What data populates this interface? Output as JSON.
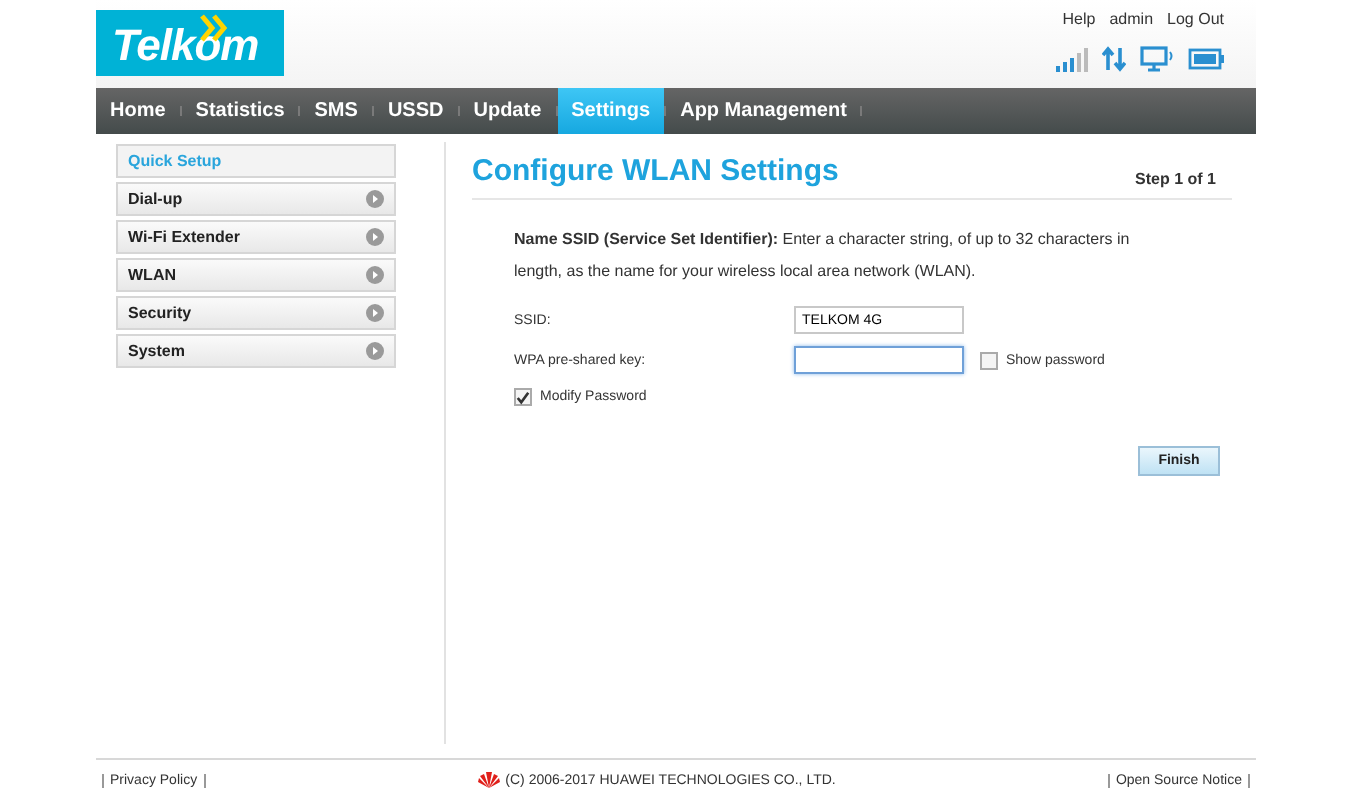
{
  "logo": {
    "text": "Telkom"
  },
  "header_links": [
    "Help",
    "admin",
    "Log Out"
  ],
  "nav": [
    {
      "label": "Home",
      "selected": false
    },
    {
      "label": "Statistics",
      "selected": false
    },
    {
      "label": "SMS",
      "selected": false
    },
    {
      "label": "USSD",
      "selected": false
    },
    {
      "label": "Update",
      "selected": false
    },
    {
      "label": "Settings",
      "selected": true
    },
    {
      "label": "App Management",
      "selected": false
    }
  ],
  "sidebar": {
    "items": [
      {
        "label": "Quick Setup",
        "selected": true,
        "expandable": false
      },
      {
        "label": "Dial-up",
        "selected": false,
        "expandable": true
      },
      {
        "label": "Wi-Fi Extender",
        "selected": false,
        "expandable": true
      },
      {
        "label": "WLAN",
        "selected": false,
        "expandable": true
      },
      {
        "label": "Security",
        "selected": false,
        "expandable": true
      },
      {
        "label": "System",
        "selected": false,
        "expandable": true
      }
    ]
  },
  "main": {
    "title": "Configure WLAN Settings",
    "step": "Step 1 of 1",
    "description": "**Name SSID (Service Set Identifier):** Enter a character string, of up to 32 characters in length, as the name for your wireless local area network (WLAN).",
    "fields": [
      {
        "label": "SSID:",
        "value": "TELKOM 4G",
        "focused": false
      },
      {
        "label": "WPA pre-shared key:",
        "focused": true,
        "option": {
          "label": "Show password",
          "checked": false
        }
      }
    ],
    "modify_password": {
      "label": "Modify Password",
      "checked": true
    },
    "finish_button": "Finish"
  },
  "footer": {
    "privacy": "Privacy Policy",
    "copyright": "(C) 2006-2017 HUAWEI TECHNOLOGIES CO., LTD.",
    "notice": "Open Source Notice"
  }
}
